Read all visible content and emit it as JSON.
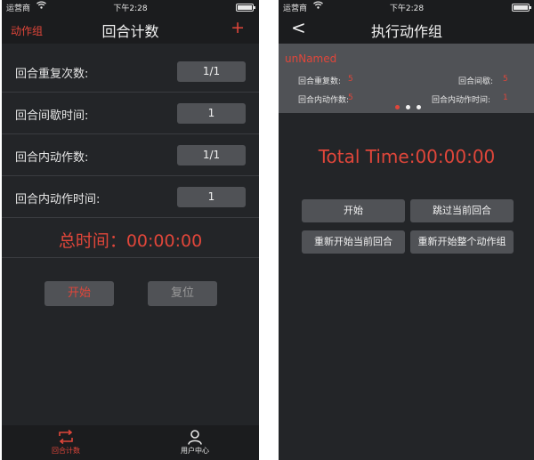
{
  "status_bar": {
    "carrier": "运营商",
    "time": "下午2:28"
  },
  "left_screen": {
    "nav": {
      "left_link": "动作组",
      "title": "回合计数",
      "add_symbol": "+"
    },
    "settings": [
      {
        "label": "回合重复次数:",
        "value": "1/1"
      },
      {
        "label": "回合间歇时间:",
        "value": "1"
      },
      {
        "label": "回合内动作数:",
        "value": "1/1"
      },
      {
        "label": "回合内动作时间:",
        "value": "1"
      }
    ],
    "total_time": "总时间：00:00:00",
    "buttons": {
      "start": "开始",
      "reset": "复位"
    },
    "tabs": [
      {
        "label": "回合计数",
        "icon": "repeat-icon",
        "active": true
      },
      {
        "label": "用户中心",
        "icon": "user-icon",
        "active": false
      }
    ]
  },
  "right_screen": {
    "nav": {
      "back_symbol": "<",
      "title": "执行动作组"
    },
    "group": {
      "name": "unNamed",
      "stats": [
        {
          "label": "回合重复数:",
          "value": "5"
        },
        {
          "label": "回合间歇:",
          "value": "5"
        },
        {
          "label": "回合内动作数:",
          "value": "5"
        },
        {
          "label": "回合内动作时间:",
          "value": "1"
        }
      ],
      "page_count": 3,
      "active_page": 0
    },
    "total_time": "Total Time:00:00:00",
    "buttons": {
      "start": "开始",
      "skip_round": "跳过当前回合",
      "restart_round": "重新开始当前回合",
      "restart_group": "重新开始整个动作组"
    }
  },
  "colors": {
    "accent": "#e0463a",
    "background": "#232528",
    "bar": "#1b1c1e",
    "control": "#505256",
    "text": "#e6e6e6",
    "disabled_text": "#9a9a9a"
  }
}
